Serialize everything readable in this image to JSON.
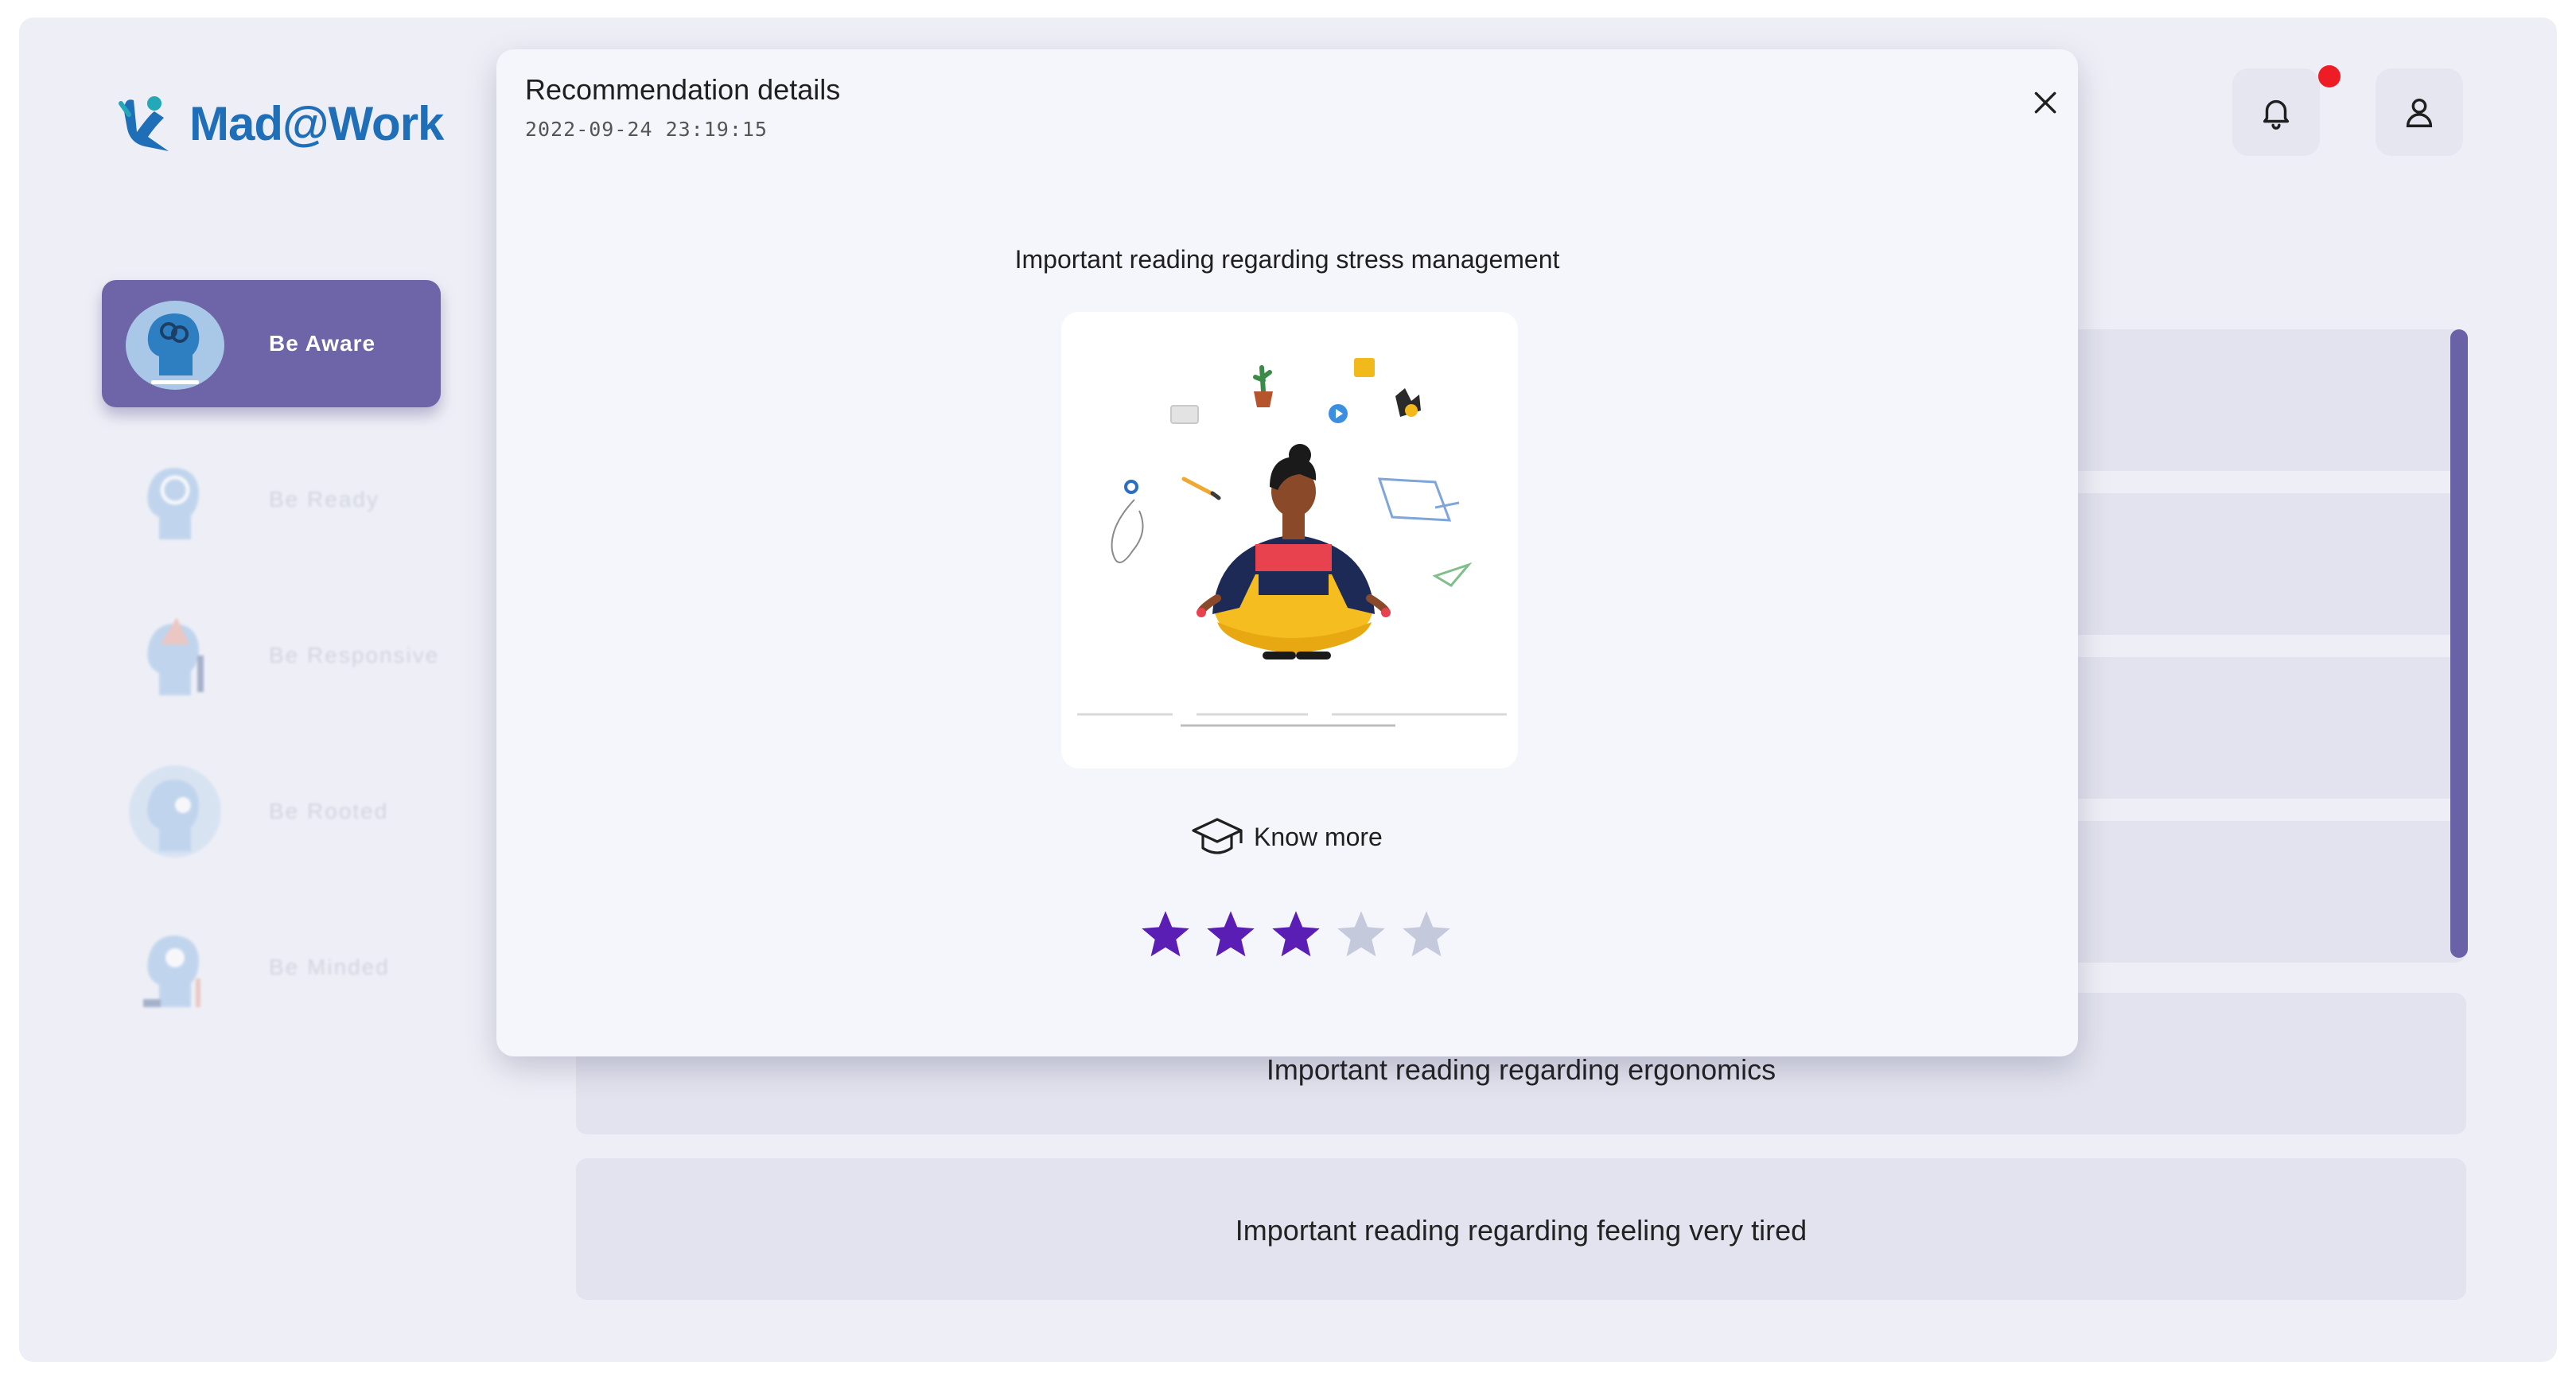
{
  "app": {
    "logo_text": "Mad@Work"
  },
  "colors": {
    "accent": "#6e64a8",
    "star_filled": "#5a1eb4",
    "star_empty": "#c4c9db",
    "notification": "#ee1c25"
  },
  "sidebar": {
    "items": [
      {
        "label": "Be Aware",
        "active": true,
        "icon": "head-aware-icon"
      },
      {
        "label": "Be Ready",
        "active": false,
        "icon": "head-ready-icon"
      },
      {
        "label": "Be Responsive",
        "active": false,
        "icon": "head-responsive-icon"
      },
      {
        "label": "Be Rooted",
        "active": false,
        "icon": "head-rooted-icon"
      },
      {
        "label": "Be Minded",
        "active": false,
        "icon": "head-minded-icon"
      }
    ]
  },
  "header": {
    "notification_icon": "bell-icon",
    "profile_icon": "user-icon"
  },
  "background_list": {
    "items": [
      "",
      "",
      "",
      "",
      "Important reading regarding ergonomics",
      "Important reading regarding feeling very tired"
    ]
  },
  "modal": {
    "title": "Recommendation details",
    "date": "2022-09-24 23:19:15",
    "heading": "Important reading regarding stress management",
    "image_alt_icon": "meditation-illustration",
    "know_more_label": "Know more",
    "rating": {
      "value": 3,
      "max": 5
    }
  }
}
